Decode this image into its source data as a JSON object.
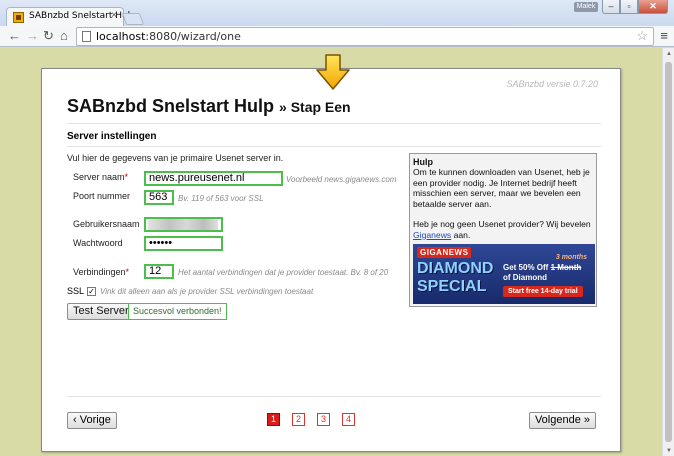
{
  "browser": {
    "tab_title": "SABnzbd Snelstart Hulp",
    "tab_close": "×",
    "user_badge": "Malek",
    "url_host": "localhost",
    "url_path": ":8080/wizard/one"
  },
  "page": {
    "version": "SABnzbd versie 0.7.20",
    "title": "SABnzbd Snelstart Hulp",
    "step": "» Stap Een",
    "section_title": "Server instellingen",
    "intro": "Vul hier de gegevens van je primaire Usenet server in.",
    "fields": {
      "server_label": "Server naam",
      "server_value": "news.pureusenet.nl",
      "server_hint": "Voorbeeld news.giganews.com",
      "port_label": "Poort nummer",
      "port_value": "563",
      "port_hint": "Bv. 119 of 563 voor SSL",
      "user_label": "Gebruikersnaam",
      "password_label": "Wachtwoord",
      "password_value": "••••••",
      "connections_label": "Verbindingen",
      "connections_value": "12",
      "connections_hint": "Het aantal verbindingen dat je provider toestaat. Bv. 8 of 20",
      "ssl_label": "SSL",
      "ssl_checked": true,
      "ssl_hint": "Vink dit alleen aan als je provider SSL verbindingen toestaat"
    },
    "test_button": "Test Server",
    "test_result": "Succesvol verbonden!",
    "help": {
      "title": "Hulp",
      "text1": "Om te kunnen downloaden van Usenet, heb je een provider nodig. Je Internet bedrijf heeft misschien een server, maar we bevelen een betaalde server aan.",
      "text2_pre": "Heb je nog geen Usenet provider? Wij bevelen ",
      "text2_link": "Giganews",
      "text2_post": " aan.",
      "ad": {
        "brand": "GIGANEWS",
        "line1": "DIAMOND",
        "line2": "SPECIAL",
        "offer_pre": "Get 50% Off",
        "offer_months": "3 months",
        "offer_strike": "1 Month",
        "offer_post": "of Diamond",
        "cta": "Start free 14-day trial"
      }
    },
    "footer": {
      "prev": "‹ Vorige",
      "next": "Volgende »",
      "pages": [
        "1",
        "2",
        "3",
        "4"
      ],
      "active_page": "1"
    }
  },
  "colors": {
    "page_bg": "#d9dba6",
    "valid_border": "#4cbe4c",
    "pager_active": "#d91c1c"
  }
}
